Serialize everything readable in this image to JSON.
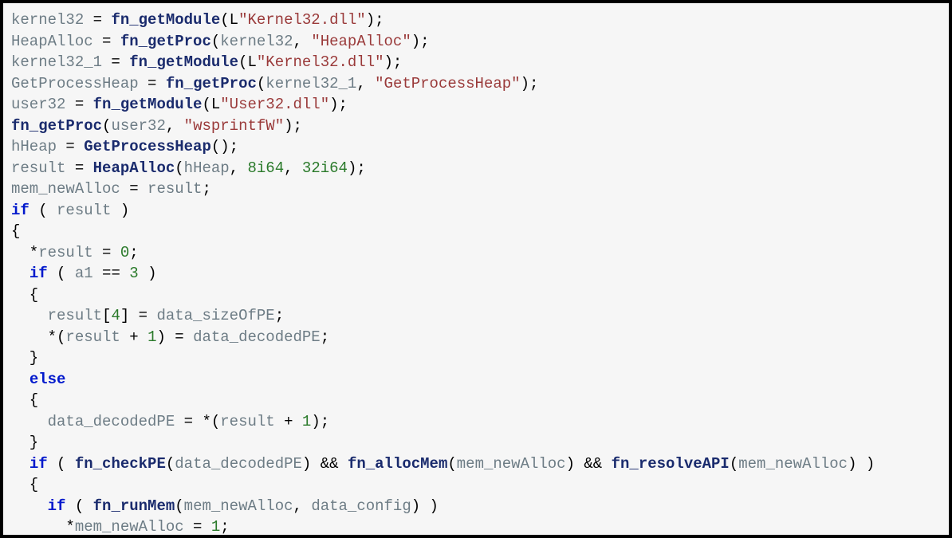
{
  "code": {
    "lines": [
      [
        {
          "cls": "c-id",
          "t": "kernel32"
        },
        {
          "cls": "c-op",
          "t": " = "
        },
        {
          "cls": "c-fn",
          "t": "fn_getModule"
        },
        {
          "cls": "c-op",
          "t": "("
        },
        {
          "cls": "c-lpfx",
          "t": "L"
        },
        {
          "cls": "c-str",
          "t": "\"Kernel32.dll\""
        },
        {
          "cls": "c-op",
          "t": ");"
        }
      ],
      [
        {
          "cls": "c-id",
          "t": "HeapAlloc"
        },
        {
          "cls": "c-op",
          "t": " = "
        },
        {
          "cls": "c-fn",
          "t": "fn_getProc"
        },
        {
          "cls": "c-op",
          "t": "("
        },
        {
          "cls": "c-id",
          "t": "kernel32"
        },
        {
          "cls": "c-op",
          "t": ", "
        },
        {
          "cls": "c-str",
          "t": "\"HeapAlloc\""
        },
        {
          "cls": "c-op",
          "t": ");"
        }
      ],
      [
        {
          "cls": "c-id",
          "t": "kernel32_1"
        },
        {
          "cls": "c-op",
          "t": " = "
        },
        {
          "cls": "c-fn",
          "t": "fn_getModule"
        },
        {
          "cls": "c-op",
          "t": "("
        },
        {
          "cls": "c-lpfx",
          "t": "L"
        },
        {
          "cls": "c-str",
          "t": "\"Kernel32.dll\""
        },
        {
          "cls": "c-op",
          "t": ");"
        }
      ],
      [
        {
          "cls": "c-id",
          "t": "GetProcessHeap"
        },
        {
          "cls": "c-op",
          "t": " = "
        },
        {
          "cls": "c-fn",
          "t": "fn_getProc"
        },
        {
          "cls": "c-op",
          "t": "("
        },
        {
          "cls": "c-id",
          "t": "kernel32_1"
        },
        {
          "cls": "c-op",
          "t": ", "
        },
        {
          "cls": "c-str",
          "t": "\"GetProcessHeap\""
        },
        {
          "cls": "c-op",
          "t": ");"
        }
      ],
      [
        {
          "cls": "c-id",
          "t": "user32"
        },
        {
          "cls": "c-op",
          "t": " = "
        },
        {
          "cls": "c-fn",
          "t": "fn_getModule"
        },
        {
          "cls": "c-op",
          "t": "("
        },
        {
          "cls": "c-lpfx",
          "t": "L"
        },
        {
          "cls": "c-str",
          "t": "\"User32.dll\""
        },
        {
          "cls": "c-op",
          "t": ");"
        }
      ],
      [
        {
          "cls": "c-fn",
          "t": "fn_getProc"
        },
        {
          "cls": "c-op",
          "t": "("
        },
        {
          "cls": "c-id",
          "t": "user32"
        },
        {
          "cls": "c-op",
          "t": ", "
        },
        {
          "cls": "c-str",
          "t": "\"wsprintfW\""
        },
        {
          "cls": "c-op",
          "t": ");"
        }
      ],
      [
        {
          "cls": "c-id",
          "t": "hHeap"
        },
        {
          "cls": "c-op",
          "t": " = "
        },
        {
          "cls": "c-fn",
          "t": "GetProcessHeap"
        },
        {
          "cls": "c-op",
          "t": "();"
        }
      ],
      [
        {
          "cls": "c-id",
          "t": "result"
        },
        {
          "cls": "c-op",
          "t": " = "
        },
        {
          "cls": "c-fn",
          "t": "HeapAlloc"
        },
        {
          "cls": "c-op",
          "t": "("
        },
        {
          "cls": "c-id",
          "t": "hHeap"
        },
        {
          "cls": "c-op",
          "t": ", "
        },
        {
          "cls": "c-num",
          "t": "8i64"
        },
        {
          "cls": "c-op",
          "t": ", "
        },
        {
          "cls": "c-num",
          "t": "32i64"
        },
        {
          "cls": "c-op",
          "t": ");"
        }
      ],
      [
        {
          "cls": "c-id",
          "t": "mem_newAlloc"
        },
        {
          "cls": "c-op",
          "t": " = "
        },
        {
          "cls": "c-id",
          "t": "result"
        },
        {
          "cls": "c-op",
          "t": ";"
        }
      ],
      [
        {
          "cls": "c-kw",
          "t": "if"
        },
        {
          "cls": "c-op",
          "t": " ( "
        },
        {
          "cls": "c-id",
          "t": "result"
        },
        {
          "cls": "c-op",
          "t": " )"
        }
      ],
      [
        {
          "cls": "c-op",
          "t": "{"
        }
      ],
      [
        {
          "cls": "c-op",
          "t": "  *"
        },
        {
          "cls": "c-id",
          "t": "result"
        },
        {
          "cls": "c-op",
          "t": " = "
        },
        {
          "cls": "c-num",
          "t": "0"
        },
        {
          "cls": "c-op",
          "t": ";"
        }
      ],
      [
        {
          "cls": "c-op",
          "t": "  "
        },
        {
          "cls": "c-kw",
          "t": "if"
        },
        {
          "cls": "c-op",
          "t": " ( "
        },
        {
          "cls": "c-id",
          "t": "a1"
        },
        {
          "cls": "c-op",
          "t": " == "
        },
        {
          "cls": "c-num",
          "t": "3"
        },
        {
          "cls": "c-op",
          "t": " )"
        }
      ],
      [
        {
          "cls": "c-op",
          "t": "  {"
        }
      ],
      [
        {
          "cls": "c-op",
          "t": "    "
        },
        {
          "cls": "c-id",
          "t": "result"
        },
        {
          "cls": "c-op",
          "t": "["
        },
        {
          "cls": "c-num",
          "t": "4"
        },
        {
          "cls": "c-op",
          "t": "] = "
        },
        {
          "cls": "c-id",
          "t": "data_sizeOfPE"
        },
        {
          "cls": "c-op",
          "t": ";"
        }
      ],
      [
        {
          "cls": "c-op",
          "t": "    *("
        },
        {
          "cls": "c-id",
          "t": "result"
        },
        {
          "cls": "c-op",
          "t": " + "
        },
        {
          "cls": "c-num",
          "t": "1"
        },
        {
          "cls": "c-op",
          "t": ") = "
        },
        {
          "cls": "c-id",
          "t": "data_decodedPE"
        },
        {
          "cls": "c-op",
          "t": ";"
        }
      ],
      [
        {
          "cls": "c-op",
          "t": "  }"
        }
      ],
      [
        {
          "cls": "c-op",
          "t": "  "
        },
        {
          "cls": "c-kw",
          "t": "else"
        }
      ],
      [
        {
          "cls": "c-op",
          "t": "  {"
        }
      ],
      [
        {
          "cls": "c-op",
          "t": "    "
        },
        {
          "cls": "c-id",
          "t": "data_decodedPE"
        },
        {
          "cls": "c-op",
          "t": " = *("
        },
        {
          "cls": "c-id",
          "t": "result"
        },
        {
          "cls": "c-op",
          "t": " + "
        },
        {
          "cls": "c-num",
          "t": "1"
        },
        {
          "cls": "c-op",
          "t": ");"
        }
      ],
      [
        {
          "cls": "c-op",
          "t": "  }"
        }
      ],
      [
        {
          "cls": "c-op",
          "t": "  "
        },
        {
          "cls": "c-kw",
          "t": "if"
        },
        {
          "cls": "c-op",
          "t": " ( "
        },
        {
          "cls": "c-fn",
          "t": "fn_checkPE"
        },
        {
          "cls": "c-op",
          "t": "("
        },
        {
          "cls": "c-id",
          "t": "data_decodedPE"
        },
        {
          "cls": "c-op",
          "t": ") && "
        },
        {
          "cls": "c-fn",
          "t": "fn_allocMem"
        },
        {
          "cls": "c-op",
          "t": "("
        },
        {
          "cls": "c-id",
          "t": "mem_newAlloc"
        },
        {
          "cls": "c-op",
          "t": ") && "
        },
        {
          "cls": "c-fn",
          "t": "fn_resolveAPI"
        },
        {
          "cls": "c-op",
          "t": "("
        },
        {
          "cls": "c-id",
          "t": "mem_newAlloc"
        },
        {
          "cls": "c-op",
          "t": ") )"
        }
      ],
      [
        {
          "cls": "c-op",
          "t": "  {"
        }
      ],
      [
        {
          "cls": "c-op",
          "t": "    "
        },
        {
          "cls": "c-kw",
          "t": "if"
        },
        {
          "cls": "c-op",
          "t": " ( "
        },
        {
          "cls": "c-fn",
          "t": "fn_runMem"
        },
        {
          "cls": "c-op",
          "t": "("
        },
        {
          "cls": "c-id",
          "t": "mem_newAlloc"
        },
        {
          "cls": "c-op",
          "t": ", "
        },
        {
          "cls": "c-id",
          "t": "data_config"
        },
        {
          "cls": "c-op",
          "t": ") )"
        }
      ],
      [
        {
          "cls": "c-op",
          "t": "      *"
        },
        {
          "cls": "c-id",
          "t": "mem_newAlloc"
        },
        {
          "cls": "c-op",
          "t": " = "
        },
        {
          "cls": "c-num",
          "t": "1"
        },
        {
          "cls": "c-op",
          "t": ";"
        }
      ]
    ]
  }
}
